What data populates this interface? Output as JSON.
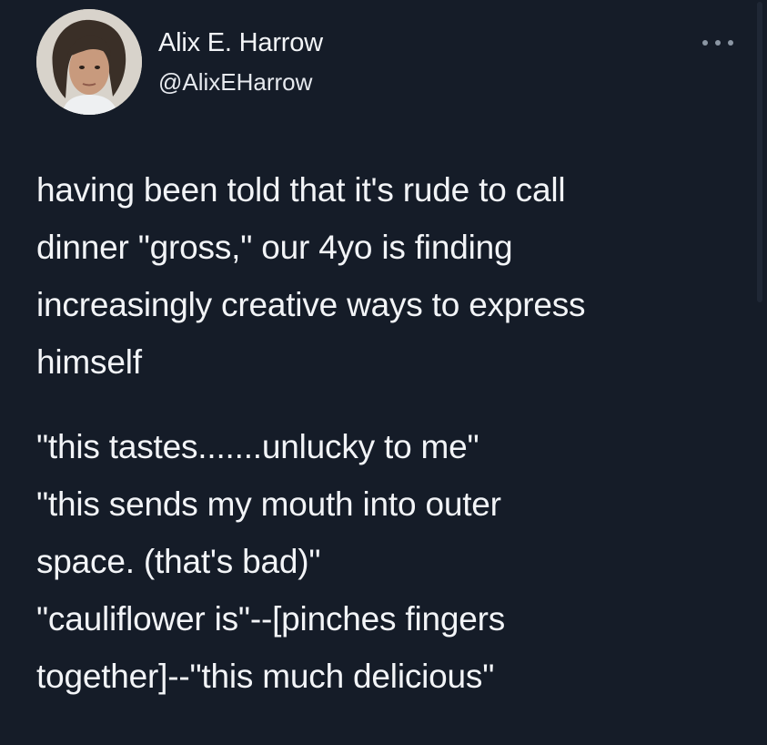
{
  "author": {
    "name": "Alix E. Harrow",
    "handle": "@AlixEHarrow",
    "avatar_icon": "profile-photo"
  },
  "menu": {
    "icon": "more-options-icon"
  },
  "tweet": {
    "paragraph_1": [
      "having been told that it's rude to call",
      "dinner \"gross,\" our 4yo is finding",
      "increasingly creative ways to express",
      "himself"
    ],
    "paragraph_2": [
      "\"this tastes.......unlucky to me\"",
      "\"this sends my mouth into outer",
      "space. (that's bad)\"",
      "\"cauliflower is\"--[pinches fingers",
      "together]--\"this much delicious\""
    ]
  },
  "colors": {
    "background": "#151c28",
    "text": "#f2f4f7",
    "muted": "#8b96a3"
  }
}
